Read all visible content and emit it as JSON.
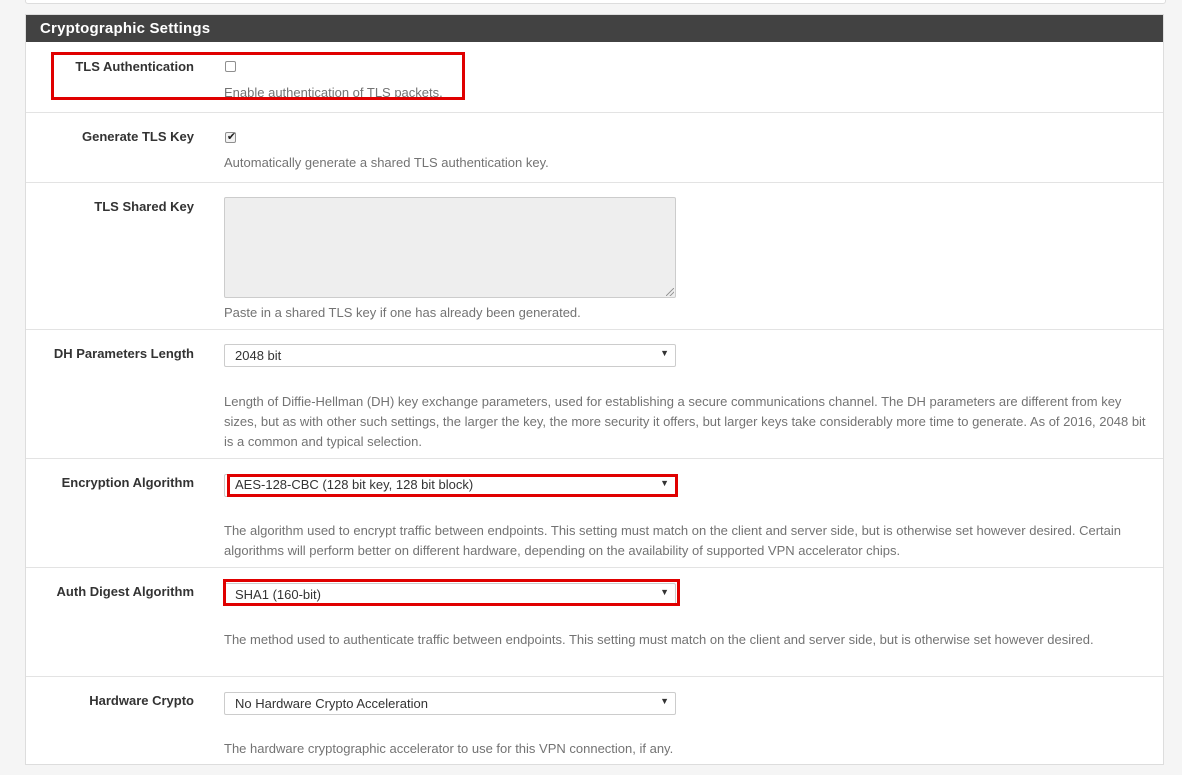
{
  "section": {
    "title": "Cryptographic Settings"
  },
  "tls_auth": {
    "label": "TLS Authentication",
    "checked": false,
    "help": "Enable authentication of TLS packets."
  },
  "gen_tls_key": {
    "label": "Generate TLS Key",
    "checked": true,
    "help": "Automatically generate a shared TLS authentication key."
  },
  "tls_shared_key": {
    "label": "TLS Shared Key",
    "value": "",
    "help": "Paste in a shared TLS key if one has already been generated."
  },
  "dh_length": {
    "label": "DH Parameters Length",
    "selected": "2048 bit",
    "help": "Length of Diffie-Hellman (DH) key exchange parameters, used for establishing a secure communications channel. The DH parameters are different from key sizes, but as with other such settings, the larger the key, the more security it offers, but larger keys take considerably more time to generate. As of 2016, 2048 bit is a common and typical selection."
  },
  "encryption": {
    "label": "Encryption Algorithm",
    "selected": "AES-128-CBC (128 bit key, 128 bit block)",
    "help": "The algorithm used to encrypt traffic between endpoints. This setting must match on the client and server side, but is otherwise set however desired. Certain algorithms will perform better on different hardware, depending on the availability of supported VPN accelerator chips."
  },
  "auth_digest": {
    "label": "Auth Digest Algorithm",
    "selected": "SHA1 (160-bit)",
    "help": "The method used to authenticate traffic between endpoints. This setting must match on the client and server side, but is otherwise set however desired."
  },
  "hw_crypto": {
    "label": "Hardware Crypto",
    "selected": "No Hardware Crypto Acceleration",
    "help": "The hardware cryptographic accelerator to use for this VPN connection, if any."
  },
  "icons": {
    "check": "✔",
    "dropdown": "▼"
  },
  "colors": {
    "heading_bg": "#424242",
    "highlight": "#e00000"
  }
}
